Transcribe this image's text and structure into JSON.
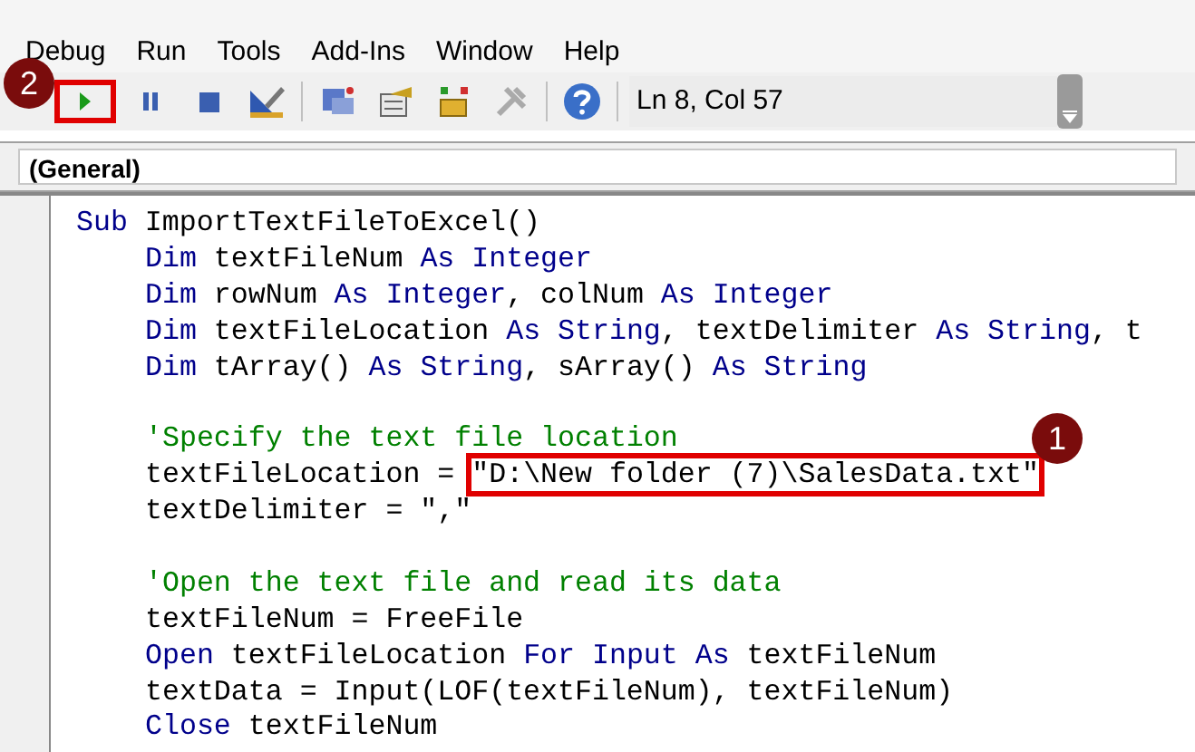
{
  "menu": [
    "Debug",
    "Run",
    "Tools",
    "Add-Ins",
    "Window",
    "Help"
  ],
  "toolbar": {
    "run_button": {
      "highlighted": true,
      "badge": "2"
    },
    "position": "Ln 8, Col 57"
  },
  "object_dropdown": "(General)",
  "code": [
    {
      "segments": [
        {
          "kind": "keyword",
          "text": "Sub"
        },
        {
          "kind": "plain",
          "text": " ImportTextFileToExcel()"
        }
      ],
      "children": [
        {
          "lines": [
            {
              "segments": [
                {
                  "kind": "keyword",
                  "text": "Dim"
                },
                {
                  "kind": "plain",
                  "text": " textFileNum "
                },
                {
                  "kind": "keyword",
                  "text": "As Integer"
                }
              ]
            },
            {
              "segments": [
                {
                  "kind": "keyword",
                  "text": "Dim"
                },
                {
                  "kind": "plain",
                  "text": " rowNum "
                },
                {
                  "kind": "keyword",
                  "text": "As Integer"
                },
                {
                  "kind": "plain",
                  "text": ", colNum "
                },
                {
                  "kind": "keyword",
                  "text": "As Integer"
                }
              ]
            },
            {
              "segments": [
                {
                  "kind": "keyword",
                  "text": "Dim"
                },
                {
                  "kind": "plain",
                  "text": " textFileLocation "
                },
                {
                  "kind": "keyword",
                  "text": "As String"
                },
                {
                  "kind": "plain",
                  "text": ", textDelimiter "
                },
                {
                  "kind": "keyword",
                  "text": "As String"
                },
                {
                  "kind": "plain",
                  "text": ", t"
                }
              ]
            },
            {
              "segments": [
                {
                  "kind": "keyword",
                  "text": "Dim"
                },
                {
                  "kind": "plain",
                  "text": " tArray() "
                },
                {
                  "kind": "keyword",
                  "text": "As String"
                },
                {
                  "kind": "plain",
                  "text": ", sArray() "
                },
                {
                  "kind": "keyword",
                  "text": "As String"
                }
              ]
            }
          ]
        },
        {
          "lines": [
            {
              "segments": [
                {
                  "kind": "comment",
                  "text": "'Specify the text file location"
                }
              ]
            },
            {
              "segments": [
                {
                  "kind": "plain",
                  "text": "textFileLocation = "
                },
                {
                  "kind": "plain",
                  "text": "\"D:\\New folder (7)\\SalesData.txt\"",
                  "highlighted": true,
                  "badge": "1"
                }
              ]
            },
            {
              "segments": [
                {
                  "kind": "plain",
                  "text": "textDelimiter = \",\""
                }
              ]
            }
          ]
        },
        {
          "lines": [
            {
              "segments": [
                {
                  "kind": "comment",
                  "text": "'Open the text file and read its data"
                }
              ]
            },
            {
              "segments": [
                {
                  "kind": "plain",
                  "text": "textFileNum = FreeFile"
                }
              ]
            },
            {
              "segments": [
                {
                  "kind": "keyword",
                  "text": "Open"
                },
                {
                  "kind": "plain",
                  "text": " textFileLocation "
                },
                {
                  "kind": "keyword",
                  "text": "For Input As"
                },
                {
                  "kind": "plain",
                  "text": " textFileNum"
                }
              ]
            },
            {
              "segments": [
                {
                  "kind": "plain",
                  "text": "textData = Input(LOF(textFileNum), textFileNum)"
                }
              ]
            },
            {
              "segments": [
                {
                  "kind": "keyword",
                  "text": "Close"
                },
                {
                  "kind": "plain",
                  "text": " textFileNum"
                }
              ]
            }
          ]
        }
      ]
    }
  ]
}
